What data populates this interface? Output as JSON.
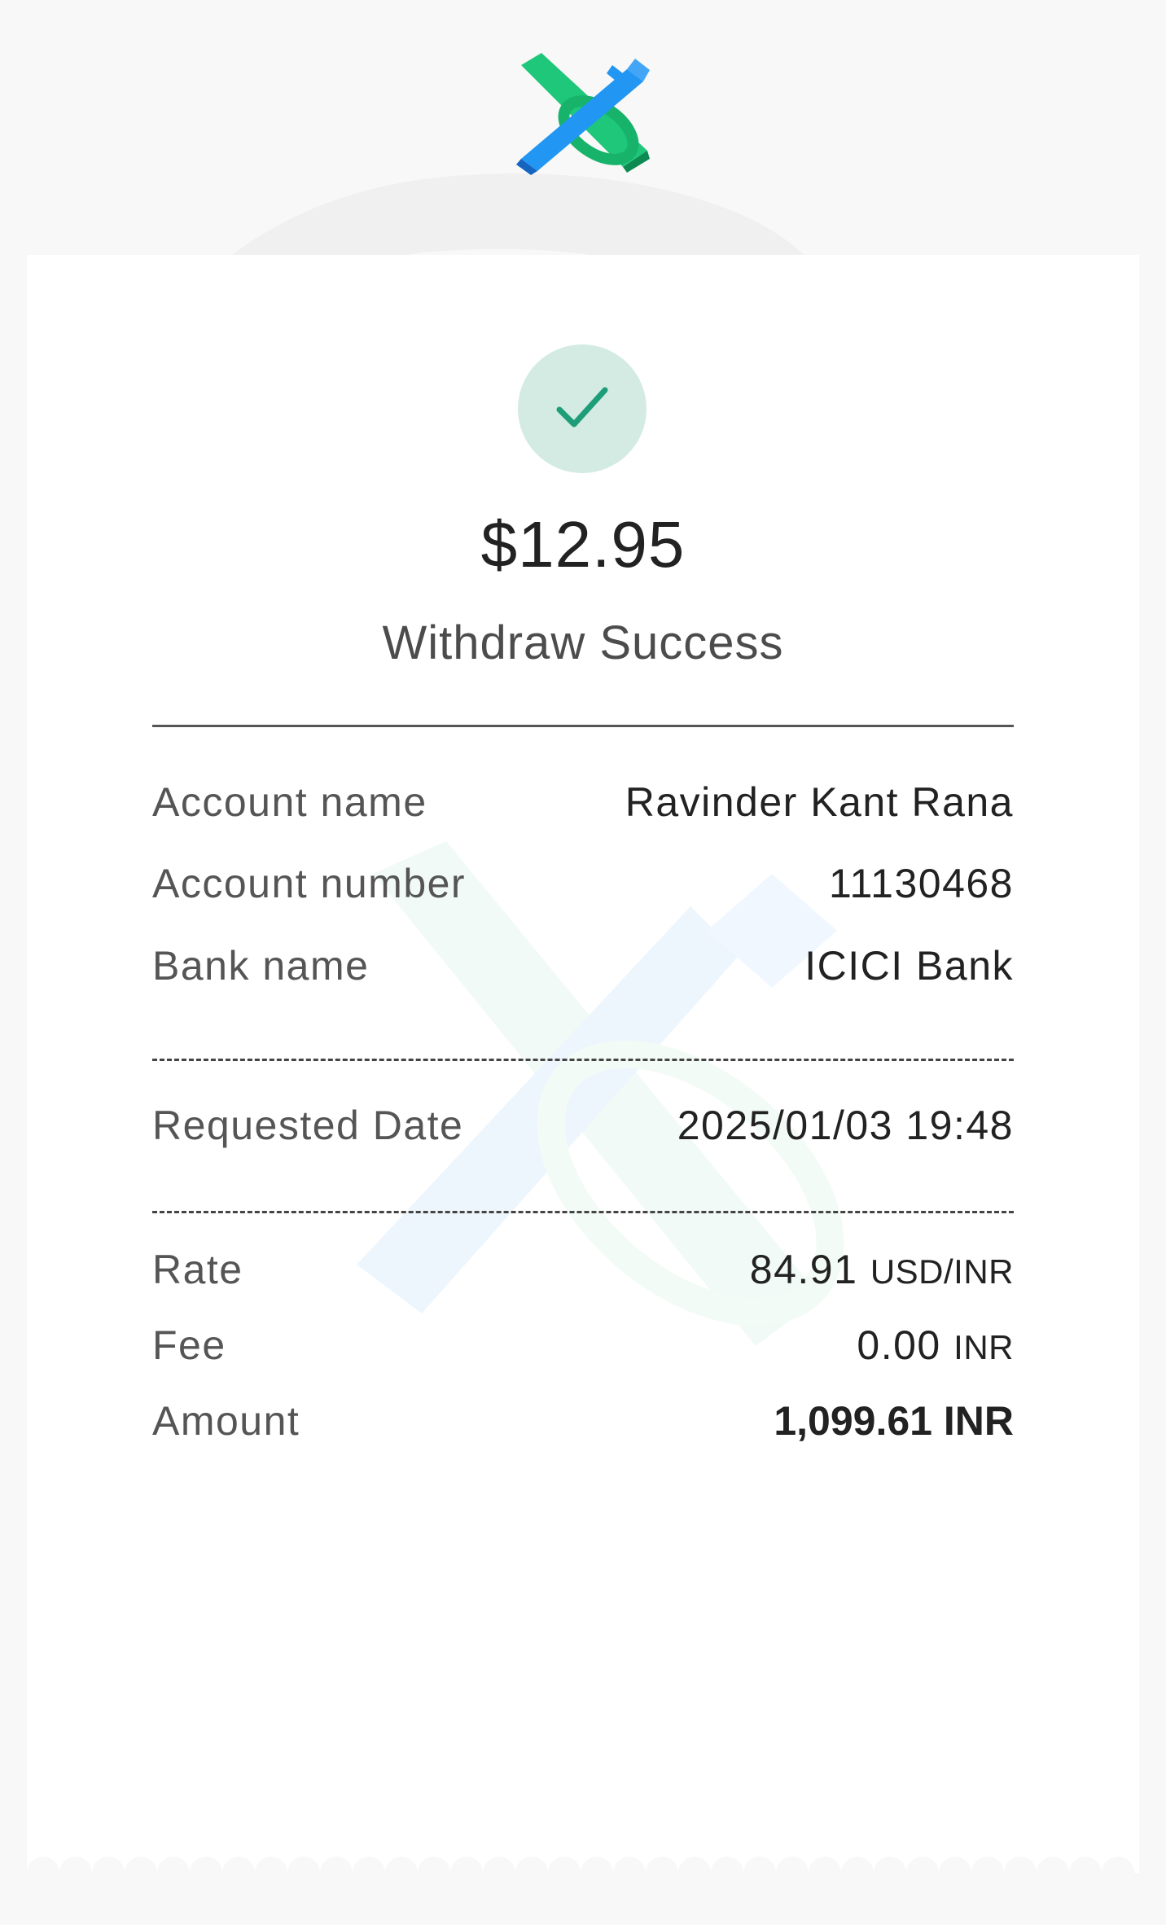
{
  "brand": {
    "logo_icon": "x-cross-logo-icon",
    "accent_green": "#1fc77a",
    "accent_blue": "#2196f3"
  },
  "receipt": {
    "status_icon": "check-icon",
    "amount": "$12.95",
    "status": "Withdraw Success",
    "account": {
      "name_label": "Account name",
      "name_value": "Ravinder Kant Rana",
      "number_label": "Account number",
      "number_value": "11130468",
      "bank_label": "Bank name",
      "bank_value": "ICICI Bank"
    },
    "request": {
      "date_label": "Requested Date",
      "date_value": "2025/01/03 19:48"
    },
    "summary": {
      "rate_label": "Rate",
      "rate_value": "84.91",
      "rate_unit": "USD/INR",
      "fee_label": "Fee",
      "fee_value": "0.00",
      "fee_unit": "INR",
      "amount_label": "Amount",
      "amount_value": "1,099.61 INR"
    }
  }
}
